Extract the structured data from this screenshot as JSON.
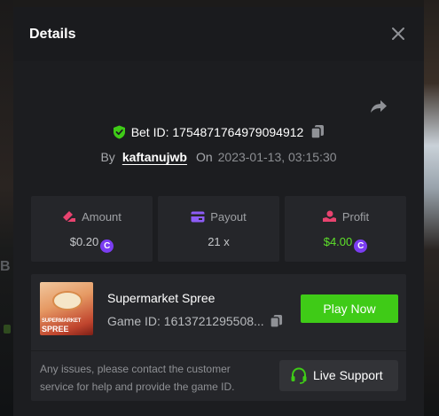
{
  "modal": {
    "title": "Details",
    "bet_id_label": "Bet ID: 1754871764979094912",
    "by_label": "By",
    "username": "kaftanujwb",
    "on_label": "On",
    "datetime": "2023-01-13, 03:15:30"
  },
  "stats": [
    {
      "label": "Amount",
      "value": "$0.20",
      "icon": "bet-amount-icon"
    },
    {
      "label": "Payout",
      "value": "21 x",
      "icon": "payout-card-icon"
    },
    {
      "label": "Profit",
      "value": "$4.00",
      "icon": "profit-hand-icon"
    }
  ],
  "game": {
    "name": "Supermarket Spree",
    "id_label": "Game ID: 1613721295508...",
    "thumb_line1": "SUPERMARKET",
    "thumb_line2": "SPREE",
    "play_label": "Play Now"
  },
  "support": {
    "text": "Any issues, please contact the customer service for help and provide the game ID.",
    "button_label": "Live Support"
  },
  "background": {
    "partial_letter": "B"
  },
  "currency_symbol": "C",
  "colors": {
    "accent_green": "#3fcb17",
    "profit_green": "#5ee02a",
    "coin_purple": "#7b3df2",
    "amount_icon": "#e8436f",
    "payout_icon": "#8d5cf6",
    "profit_icon": "#e8436f"
  }
}
